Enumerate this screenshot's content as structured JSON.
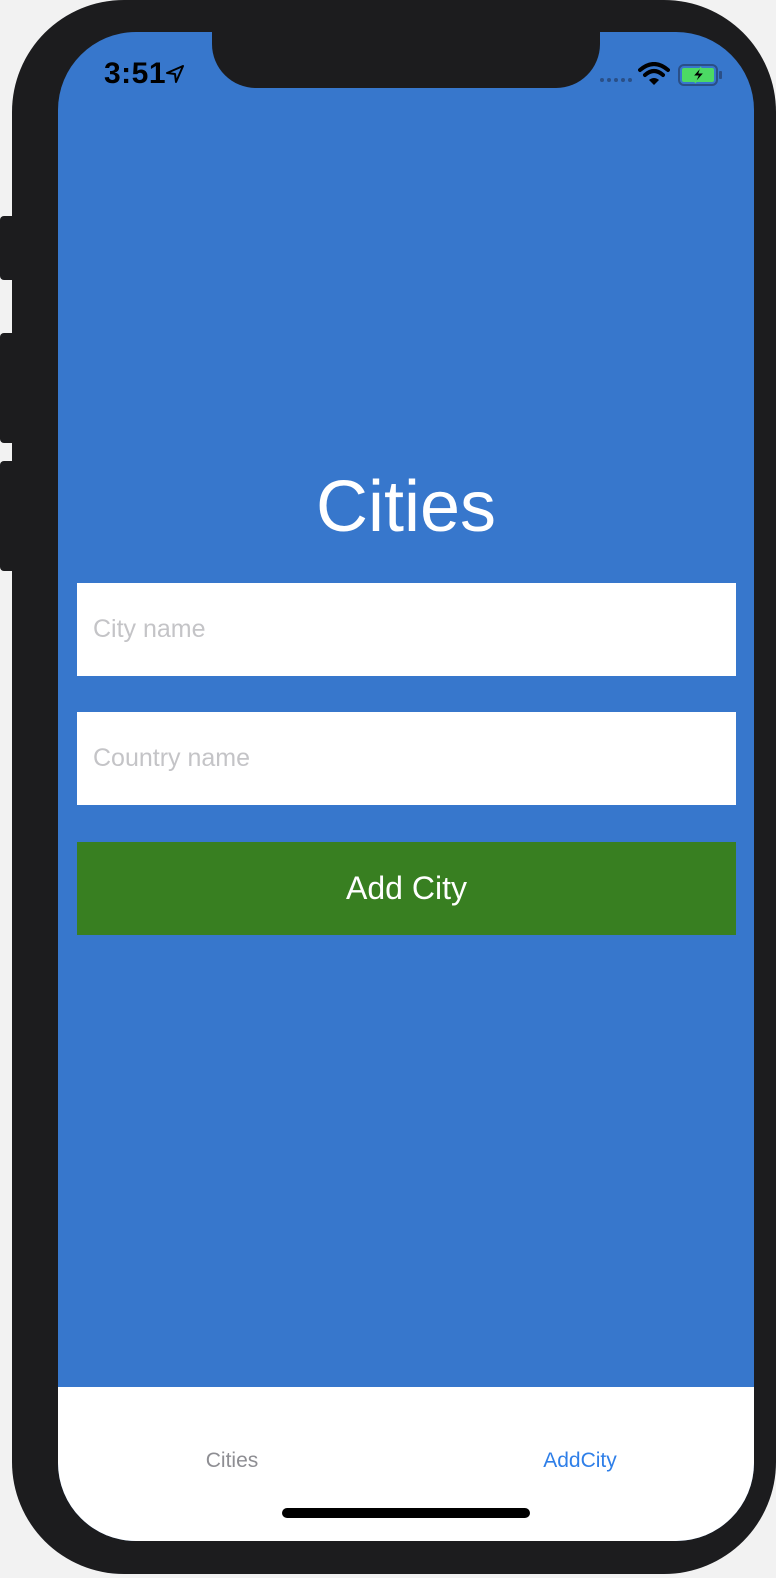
{
  "status_bar": {
    "time": "3:51",
    "icons": [
      "location-arrow-icon",
      "signal-dots-icon",
      "wifi-icon",
      "battery-charging-icon"
    ]
  },
  "main": {
    "title": "Cities",
    "city_input": {
      "placeholder": "City name",
      "value": ""
    },
    "country_input": {
      "placeholder": "Country name",
      "value": ""
    },
    "add_button_label": "Add City"
  },
  "tab_bar": {
    "tabs": [
      {
        "label": "Cities",
        "active": false
      },
      {
        "label": "AddCity",
        "active": true
      }
    ]
  },
  "colors": {
    "background": "#3777cc",
    "button": "#387f21",
    "active_tab": "#2f7fe8",
    "inactive_tab": "#8e8e93"
  }
}
